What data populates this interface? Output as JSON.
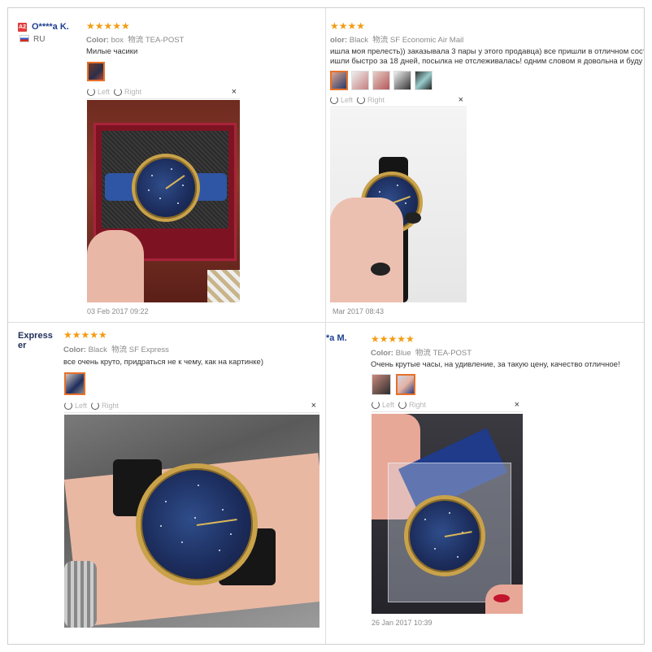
{
  "reviews": [
    {
      "user": "O****a K.",
      "badge": "A2",
      "country": "RU",
      "stars": "★★★★★",
      "color_label": "Color:",
      "color_value": "box",
      "ship_label": "物流",
      "ship_value": "TEA-POST",
      "text": "Милые часики",
      "nav_left": "Left",
      "nav_right": "Right",
      "nav_close": "×",
      "date": "03 Feb 2017 09:22"
    },
    {
      "stars": "★★★★",
      "color_label": "olor:",
      "color_value": "Black",
      "ship_label": "物流",
      "ship_value": "SF Economic Air Mail",
      "text_line1": "ишла моя прелесть)) заказывала 3 пары у этого продавца) все пришли в отличном сост",
      "text_line2": "ишли быстро за 18 дней, посылка не отслеживалась! одним словом я довольна и буду з",
      "nav_left": "Left",
      "nav_right": "Right",
      "nav_close": "×",
      "date": "Mar 2017 08:43"
    },
    {
      "user_line1": "Express",
      "user_line2": "er",
      "stars": "★★★★★",
      "color_label": "Color:",
      "color_value": "Black",
      "ship_label": "物流",
      "ship_value": "SF Express",
      "text": "все очень круто, придраться не к чему, как на картинке)",
      "nav_left": "Left",
      "nav_right": "Right",
      "nav_close": "×"
    },
    {
      "user": "*a M.",
      "stars": "★★★★★",
      "color_label": "Color:",
      "color_value": "Blue",
      "ship_label": "物流",
      "ship_value": "TEA-POST",
      "text": "Очень крутые часы, на удивление, за такую цену, качество отличное!",
      "nav_left": "Left",
      "nav_right": "Right",
      "nav_close": "×",
      "date": "26 Jan 2017 10:39"
    }
  ],
  "colors": {
    "user": "#1f3f91",
    "stars": "#f39c12",
    "selected_thumb": "#e6702b"
  }
}
